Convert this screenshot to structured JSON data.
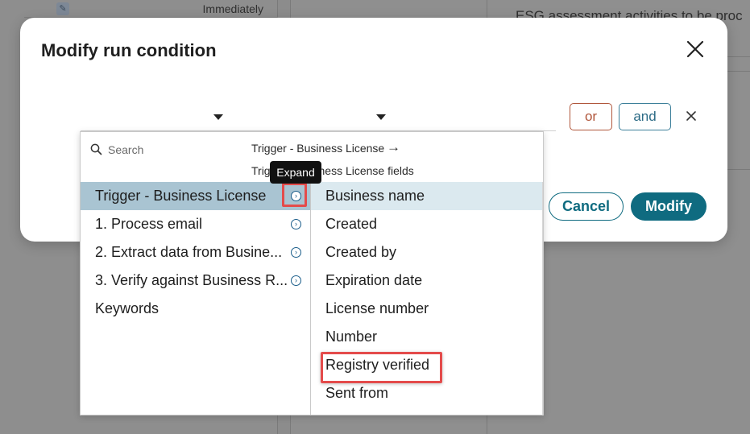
{
  "background": {
    "row_label": "Immediately",
    "right_text": "ESG assessment activities to be proc"
  },
  "modal": {
    "title": "Modify run condition",
    "or_label": "or",
    "and_label": "and",
    "cancel_label": "Cancel",
    "modify_label": "Modify"
  },
  "dropdown": {
    "search_placeholder": "Search",
    "breadcrumb_trigger": "Trigger - Business License",
    "breadcrumb_arrow": "→",
    "breadcrumb_fields": "Trigger - Business License fields",
    "left_items": [
      {
        "label": "Trigger - Business License"
      },
      {
        "label": "1. Process email"
      },
      {
        "label": "2. Extract data from Busine..."
      },
      {
        "label": "3. Verify against Business R..."
      },
      {
        "label": "Keywords"
      }
    ],
    "right_items": [
      {
        "label": "Business name"
      },
      {
        "label": "Created"
      },
      {
        "label": "Created by"
      },
      {
        "label": "Expiration date"
      },
      {
        "label": "License number"
      },
      {
        "label": "Number"
      },
      {
        "label": "Registry verified"
      },
      {
        "label": "Sent from"
      }
    ]
  },
  "tooltip": {
    "text": "Expand"
  },
  "colors": {
    "primary": "#0f6b80",
    "or_accent": "#b0563b",
    "selected_row": "#a9c4d2",
    "hover_row": "#dbe9ef",
    "annotation_red": "#e44b4b"
  }
}
